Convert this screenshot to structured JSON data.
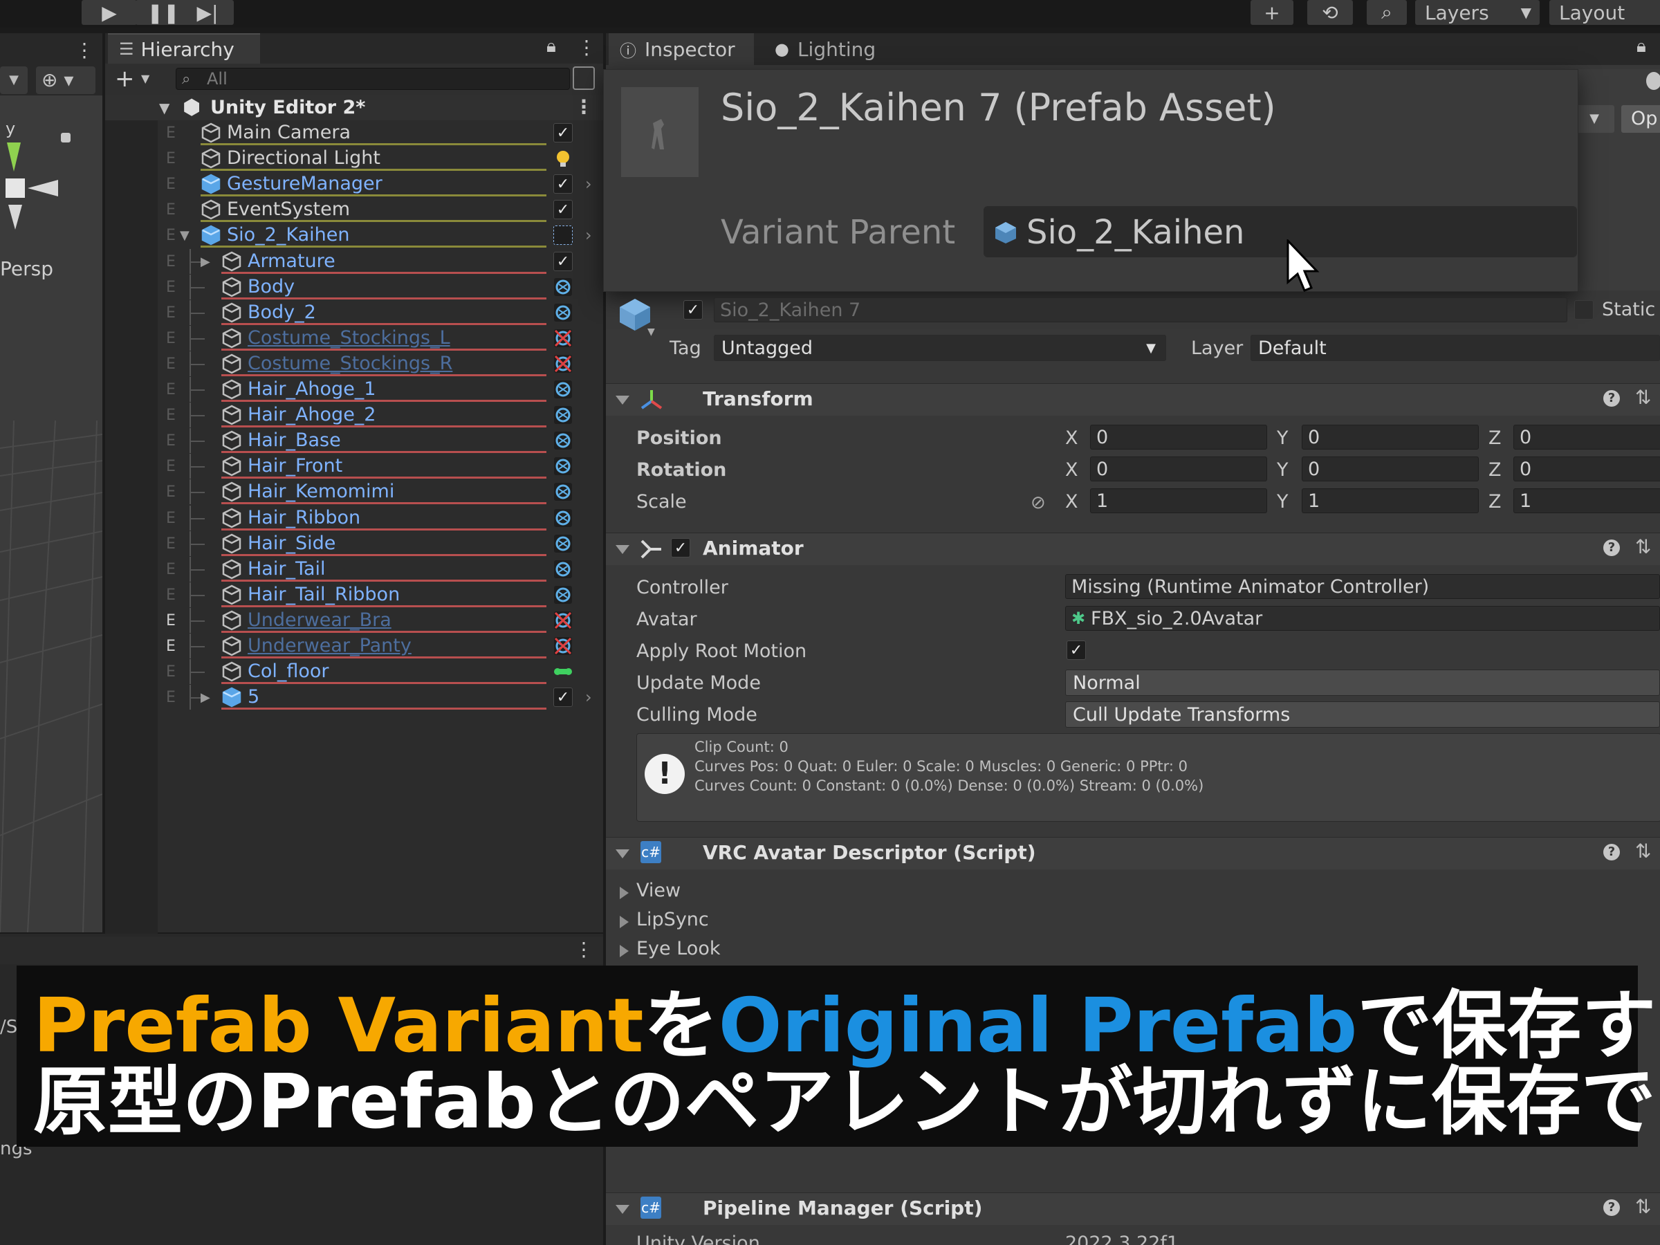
{
  "toolbar": {
    "layers_label": "Layers",
    "layout_label": "Layout"
  },
  "scene": {
    "persp_label": "Persp",
    "axis_y": "y",
    "bottom_frag_1": "/Si",
    "bottom_frag_2": "ngs"
  },
  "hierarchy": {
    "tab_label": "Hierarchy",
    "search_placeholder": "All",
    "scene_name": "Unity Editor 2*",
    "rows": [
      {
        "label": "Main Camera",
        "color": "#d2d2d2",
        "ul": "#8a8a3a",
        "indent": 0,
        "status": "check",
        "e": "E"
      },
      {
        "label": "Directional Light",
        "color": "#d2d2d2",
        "ul": "#8a8a3a",
        "indent": 0,
        "status": "bulb",
        "e": "E"
      },
      {
        "label": "GestureManager",
        "color": "#7fb3ff",
        "ul": "#8a8a3a",
        "indent": 0,
        "status": "check",
        "e": "E"
      },
      {
        "label": "EventSystem",
        "color": "#d2d2d2",
        "ul": "#8a8a3a",
        "indent": 0,
        "status": "check",
        "e": "E"
      },
      {
        "label": "Sio_2_Kaihen",
        "color": "#7fb3ff",
        "ul": "#8a8a3a",
        "indent": 0,
        "status": "dash",
        "e": "E"
      },
      {
        "label": "Armature",
        "color": "#7fb3ff",
        "ul": "#b84f4f",
        "indent": 1,
        "status": "check",
        "e": "E"
      },
      {
        "label": "Body",
        "color": "#7fb3ff",
        "ul": "#b84f4f",
        "indent": 1,
        "status": "mesh",
        "e": "E"
      },
      {
        "label": "Body_2",
        "color": "#7fb3ff",
        "ul": "#b84f4f",
        "indent": 1,
        "status": "mesh",
        "e": "E"
      },
      {
        "label": "Costume_Stockings_L",
        "color": "#4d6e9e",
        "ul": "#b84f4f",
        "indent": 1,
        "status": "meshoff",
        "e": "E"
      },
      {
        "label": "Costume_Stockings_R",
        "color": "#4d6e9e",
        "ul": "#b84f4f",
        "indent": 1,
        "status": "meshoff",
        "e": "E"
      },
      {
        "label": "Hair_Ahoge_1",
        "color": "#7fb3ff",
        "ul": "#b84f4f",
        "indent": 1,
        "status": "mesh",
        "e": "E"
      },
      {
        "label": "Hair_Ahoge_2",
        "color": "#7fb3ff",
        "ul": "#b84f4f",
        "indent": 1,
        "status": "mesh",
        "e": "E"
      },
      {
        "label": "Hair_Base",
        "color": "#7fb3ff",
        "ul": "#b84f4f",
        "indent": 1,
        "status": "mesh",
        "e": "E"
      },
      {
        "label": "Hair_Front",
        "color": "#7fb3ff",
        "ul": "#b84f4f",
        "indent": 1,
        "status": "mesh",
        "e": "E"
      },
      {
        "label": "Hair_Kemomimi",
        "color": "#7fb3ff",
        "ul": "#b84f4f",
        "indent": 1,
        "status": "mesh",
        "e": "E"
      },
      {
        "label": "Hair_Ribbon",
        "color": "#7fb3ff",
        "ul": "#b84f4f",
        "indent": 1,
        "status": "mesh",
        "e": "E"
      },
      {
        "label": "Hair_Side",
        "color": "#7fb3ff",
        "ul": "#b84f4f",
        "indent": 1,
        "status": "mesh",
        "e": "E"
      },
      {
        "label": "Hair_Tail",
        "color": "#7fb3ff",
        "ul": "#b84f4f",
        "indent": 1,
        "status": "mesh",
        "e": "E"
      },
      {
        "label": "Hair_Tail_Ribbon",
        "color": "#7fb3ff",
        "ul": "#b84f4f",
        "indent": 1,
        "status": "mesh",
        "e": "E"
      },
      {
        "label": "Underwear_Bra",
        "color": "#4d6e9e",
        "ul": "#b84f4f",
        "indent": 1,
        "status": "meshoff",
        "e": "E"
      },
      {
        "label": "Underwear_Panty",
        "color": "#4d6e9e",
        "ul": "#b84f4f",
        "indent": 1,
        "status": "meshoff",
        "e": "E"
      },
      {
        "label": "Col_floor",
        "color": "#7fb3ff",
        "ul": "#b84f4f",
        "indent": 1,
        "status": "green",
        "e": "E"
      },
      {
        "label": "5",
        "color": "#7fb3ff",
        "ul": "#b84f4f",
        "indent": 1,
        "status": "check",
        "e": "E"
      }
    ]
  },
  "inspector": {
    "tab_inspector": "Inspector",
    "tab_lighting": "Lighting",
    "popup_title": "Sio_2_Kaihen 7 (Prefab Asset)",
    "variant_parent_label": "Variant Parent",
    "variant_parent_value": "Sio_2_Kaihen",
    "object_name": "Sio_2_Kaihen 7",
    "static_label": "Static",
    "open_label": "Op",
    "tag_label": "Tag",
    "tag_value": "Untagged",
    "layer_label": "Layer",
    "layer_value": "Default",
    "transform": {
      "title": "Transform",
      "position_label": "Position",
      "rotation_label": "Rotation",
      "scale_label": "Scale",
      "axis_x": "X",
      "axis_y": "Y",
      "axis_z": "Z",
      "position": [
        "0",
        "0",
        "0"
      ],
      "rotation": [
        "0",
        "0",
        "0"
      ],
      "scale": [
        "1",
        "1",
        "1"
      ]
    },
    "animator": {
      "title": "Animator",
      "controller_label": "Controller",
      "controller_value": "Missing (Runtime Animator Controller)",
      "avatar_label": "Avatar",
      "avatar_value": "FBX_sio_2.0Avatar",
      "apply_root_motion_label": "Apply Root Motion",
      "update_mode_label": "Update Mode",
      "update_mode_value": "Normal",
      "culling_mode_label": "Culling Mode",
      "culling_mode_value": "Cull Update Transforms",
      "info_1": "Clip Count: 0",
      "info_2": "Curves Pos: 0 Quat: 0 Euler: 0 Scale: 0 Muscles: 0 Generic: 0 PPtr: 0",
      "info_3": "Curves Count: 0 Constant: 0 (0.0%) Dense: 0 (0.0%) Stream: 0 (0.0%)"
    },
    "vrc": {
      "title": "VRC Avatar Descriptor (Script)",
      "items": [
        "View",
        "LipSync",
        "Eye Look"
      ]
    },
    "pipeline": {
      "title": "Pipeline Manager (Script)",
      "frag_label": "Unity Version",
      "frag_value": "2022.3.22f1"
    }
  },
  "subtitle": {
    "line1_a": "Prefab Variant",
    "line1_b": "を",
    "line1_c": "Original Prefab",
    "line1_d": "で保存すると",
    "line2": "原型のPrefabとのペアレントが切れずに保存できる",
    "color_orange": "#f7a800",
    "color_blue": "#1b8fe0",
    "color_white": "#ffffff"
  }
}
